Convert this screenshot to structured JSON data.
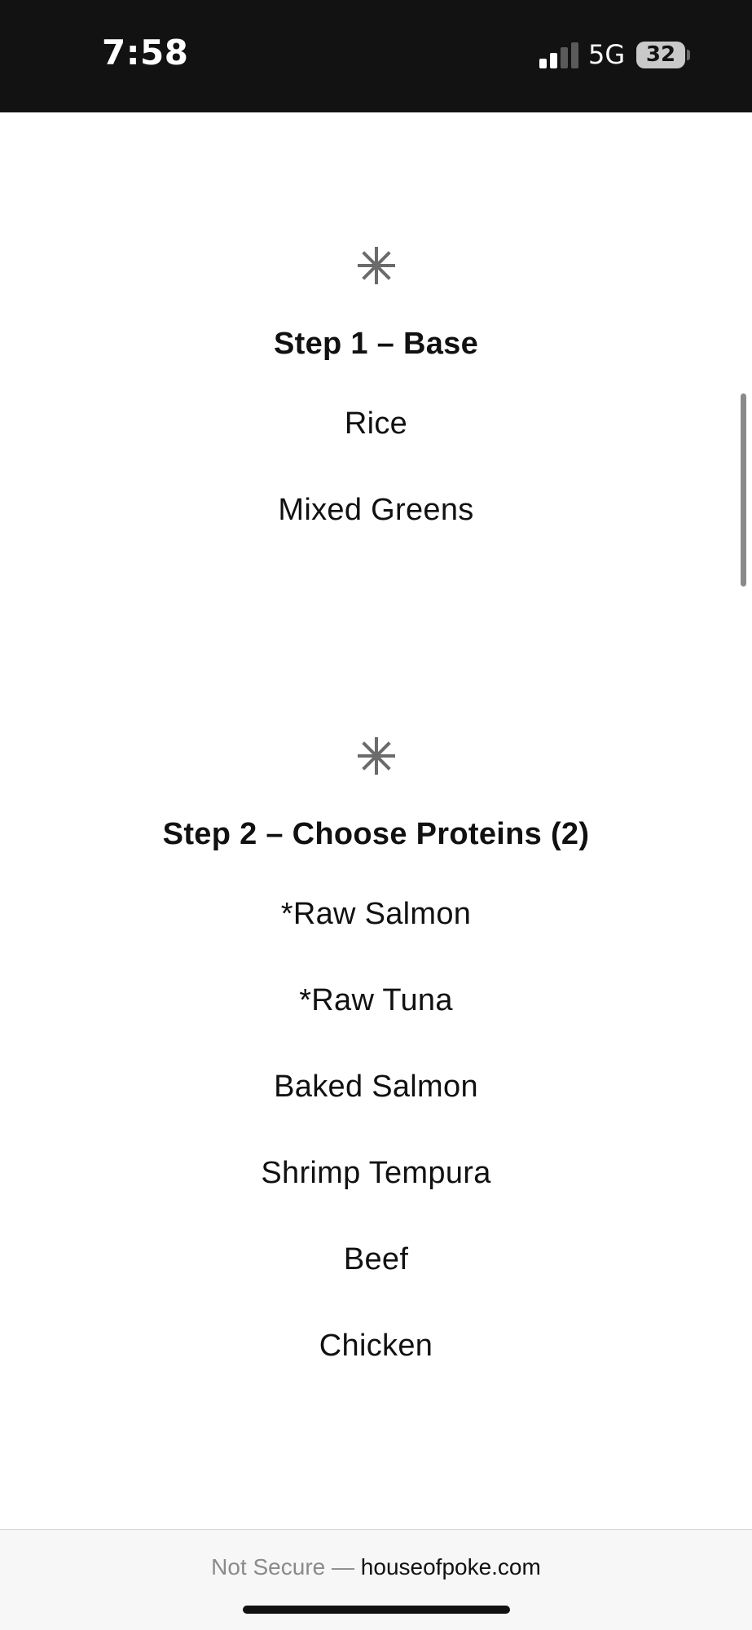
{
  "status_bar": {
    "time": "7:58",
    "network": "5G",
    "battery": "32",
    "signal_bars": 2,
    "signal_total": 4
  },
  "steps": [
    {
      "title": "Step 1 – Base",
      "options": [
        "Rice",
        "Mixed Greens"
      ]
    },
    {
      "title": "Step 2 – Choose Proteins (2)",
      "options": [
        "*Raw Salmon",
        "*Raw Tuna",
        "Baked Salmon",
        "Shrimp Tempura",
        "Beef",
        "Chicken"
      ]
    }
  ],
  "address_bar": {
    "security_label": "Not Secure —",
    "domain": "houseofpoke.com"
  },
  "colors": {
    "status_bar_bg": "#121212",
    "icon_gray": "#6b6b6b",
    "text": "#111111",
    "muted": "#8a8a8a"
  },
  "icons": {
    "section_divider": "asterisk-icon"
  }
}
